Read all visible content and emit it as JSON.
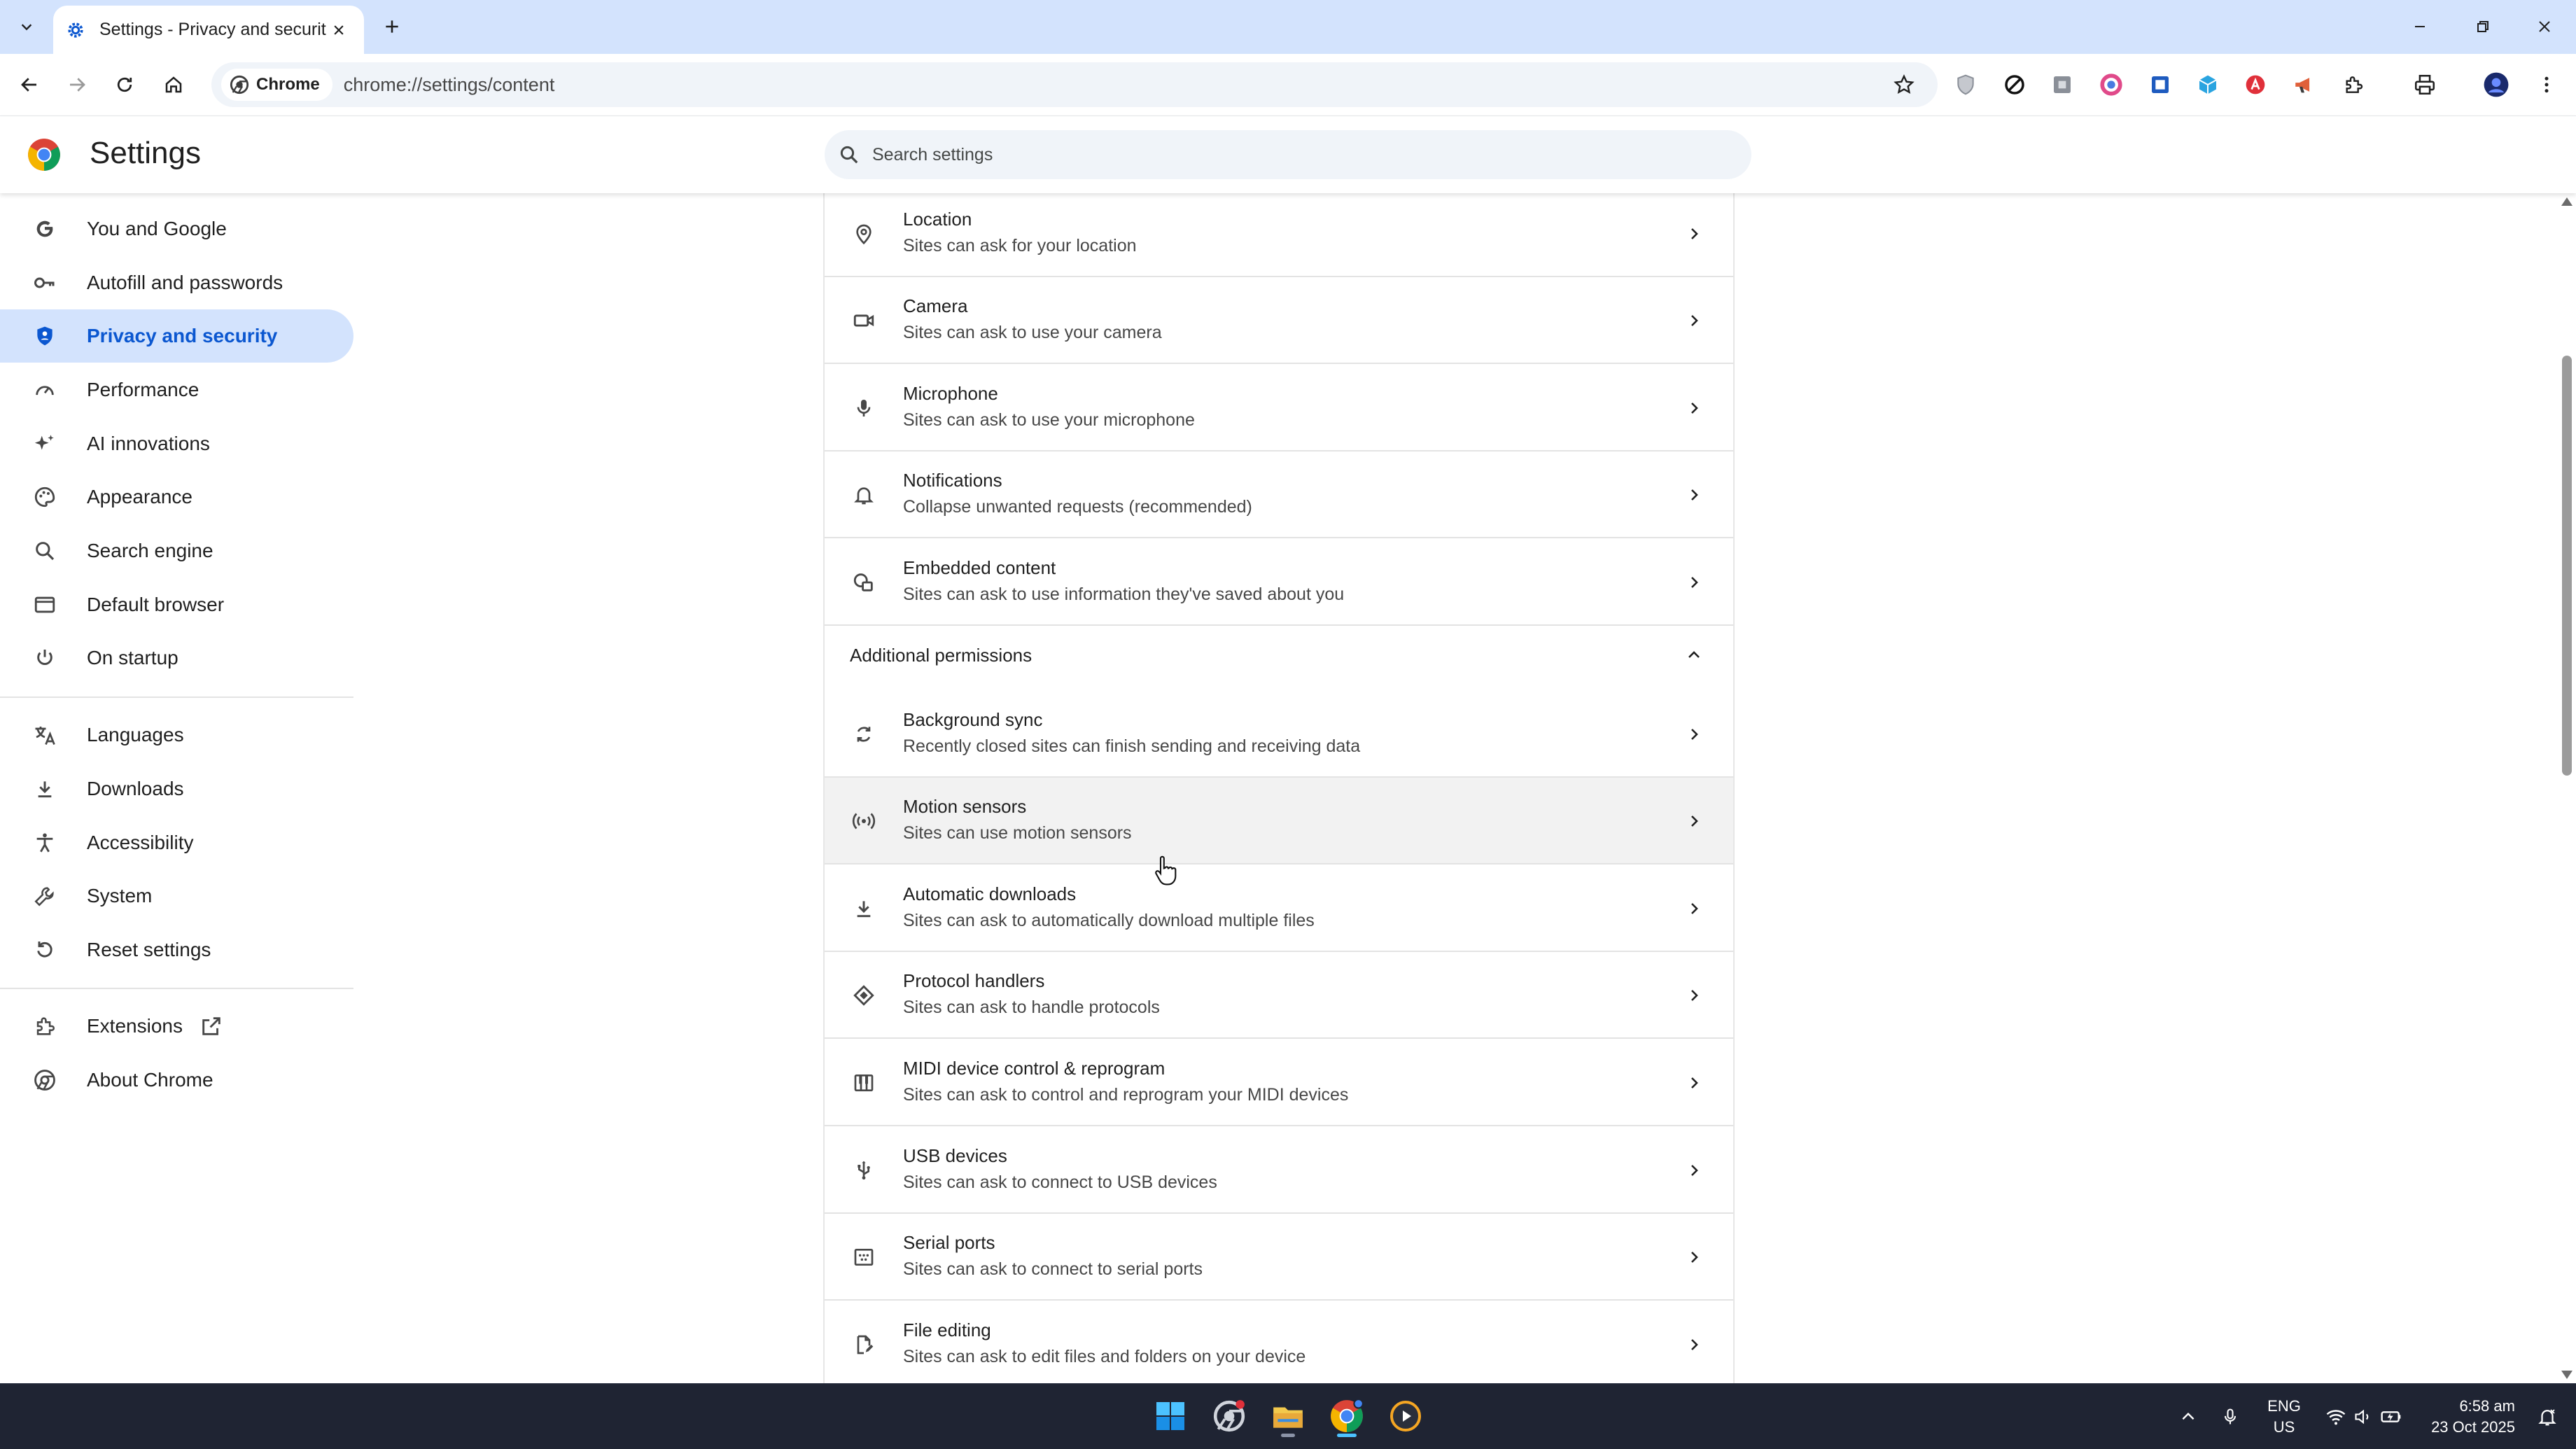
{
  "browser": {
    "tab": {
      "title": "Settings - Privacy and security"
    },
    "omnibox": {
      "chip_label": "Chrome",
      "url": "chrome://settings/content"
    }
  },
  "settings": {
    "title": "Settings",
    "search_placeholder": "Search settings"
  },
  "sidebar": {
    "items": [
      {
        "label": "You and Google",
        "icon": "google-g-icon"
      },
      {
        "label": "Autofill and passwords",
        "icon": "key-icon"
      },
      {
        "label": "Privacy and security",
        "icon": "shield-icon",
        "active": true
      },
      {
        "label": "Performance",
        "icon": "speedometer-icon"
      },
      {
        "label": "AI innovations",
        "icon": "sparkle-icon"
      },
      {
        "label": "Appearance",
        "icon": "palette-icon"
      },
      {
        "label": "Search engine",
        "icon": "search-icon"
      },
      {
        "label": "Default browser",
        "icon": "browser-window-icon"
      },
      {
        "label": "On startup",
        "icon": "power-icon"
      },
      {
        "label": "Languages",
        "icon": "translate-icon"
      },
      {
        "label": "Downloads",
        "icon": "download-icon"
      },
      {
        "label": "Accessibility",
        "icon": "accessibility-icon"
      },
      {
        "label": "System",
        "icon": "wrench-icon"
      },
      {
        "label": "Reset settings",
        "icon": "reset-icon"
      },
      {
        "label": "Extensions",
        "icon": "puzzle-icon"
      },
      {
        "label": "About Chrome",
        "icon": "chrome-icon"
      }
    ]
  },
  "permissions": {
    "rows": [
      {
        "title": "Location",
        "subtitle": "Sites can ask for your location",
        "icon": "location-pin-icon"
      },
      {
        "title": "Camera",
        "subtitle": "Sites can ask to use your camera",
        "icon": "camera-icon"
      },
      {
        "title": "Microphone",
        "subtitle": "Sites can ask to use your microphone",
        "icon": "microphone-icon"
      },
      {
        "title": "Notifications",
        "subtitle": "Collapse unwanted requests (recommended)",
        "icon": "bell-icon"
      },
      {
        "title": "Embedded content",
        "subtitle": "Sites can ask to use information they've saved about you",
        "icon": "embedded-content-icon"
      }
    ],
    "additional_title": "Additional permissions",
    "additional_rows": [
      {
        "title": "Background sync",
        "subtitle": "Recently closed sites can finish sending and receiving data",
        "icon": "sync-icon"
      },
      {
        "title": "Motion sensors",
        "subtitle": "Sites can use motion sensors",
        "icon": "motion-sensor-icon"
      },
      {
        "title": "Automatic downloads",
        "subtitle": "Sites can ask to automatically download multiple files",
        "icon": "download-icon"
      },
      {
        "title": "Protocol handlers",
        "subtitle": "Sites can ask to handle protocols",
        "icon": "protocol-handler-icon"
      },
      {
        "title": "MIDI device control & reprogram",
        "subtitle": "Sites can ask to control and reprogram your MIDI devices",
        "icon": "piano-keys-icon"
      },
      {
        "title": "USB devices",
        "subtitle": "Sites can ask to connect to USB devices",
        "icon": "usb-icon"
      },
      {
        "title": "Serial ports",
        "subtitle": "Sites can ask to connect to serial ports",
        "icon": "serial-port-icon"
      },
      {
        "title": "File editing",
        "subtitle": "Sites can ask to edit files and folders on your device",
        "icon": "file-edit-icon"
      }
    ]
  },
  "taskbar": {
    "lang_top": "ENG",
    "lang_bottom": "US",
    "time": "6:58 am",
    "date": "23 Oct 2025"
  },
  "colors": {
    "accent": "#0b57d0",
    "active_bg": "#d3e3fd",
    "tabstrip_bg": "#d3e3fd",
    "taskbar_bg": "#1f2433"
  }
}
